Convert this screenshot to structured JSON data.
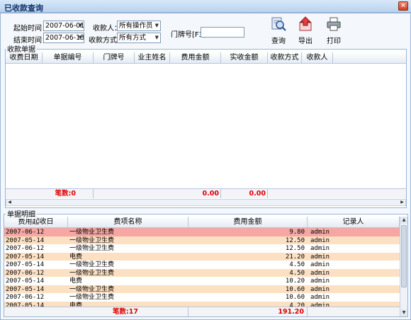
{
  "window": {
    "title": "已收款查询",
    "close_label": "×"
  },
  "filters": {
    "start_label": "起始时间：",
    "start_value": "2007-06-01",
    "end_label": "结束时间：",
    "end_value": "2007-06-13",
    "collector_label": "收款人：",
    "collector_value": "所有操作员",
    "method_label": "收款方式：",
    "method_value": "所有方式",
    "door_label": "门牌号[F3]",
    "door_value": ""
  },
  "toolbar": {
    "query_label": "查询",
    "export_label": "导出",
    "print_label": "打印"
  },
  "receipts": {
    "group_label": "收款单据",
    "columns": [
      "收费日期",
      "单据编号",
      "门牌号",
      "业主姓名",
      "费用金额",
      "实收金额",
      "收款方式",
      "收款人"
    ],
    "summary": {
      "count_label": "笔数:0",
      "fee_total": "0.00",
      "received_total": "0.00"
    }
  },
  "details": {
    "group_label": "单据明细",
    "columns": [
      "费用起收日",
      "费项名称",
      "费用金额",
      "记录人"
    ],
    "rows": [
      {
        "date": "2007-06-12",
        "item": "一级物业卫生费",
        "amount": "9.80",
        "recorder": "admin"
      },
      {
        "date": "2007-05-14",
        "item": "一级物业卫生费",
        "amount": "12.50",
        "recorder": "admin"
      },
      {
        "date": "2007-06-12",
        "item": "一级物业卫生费",
        "amount": "12.50",
        "recorder": "admin"
      },
      {
        "date": "2007-05-14",
        "item": "电费",
        "amount": "21.20",
        "recorder": "admin"
      },
      {
        "date": "2007-05-14",
        "item": "一级物业卫生费",
        "amount": "4.50",
        "recorder": "admin"
      },
      {
        "date": "2007-06-12",
        "item": "一级物业卫生费",
        "amount": "4.50",
        "recorder": "admin"
      },
      {
        "date": "2007-05-14",
        "item": "电费",
        "amount": "10.20",
        "recorder": "admin"
      },
      {
        "date": "2007-05-14",
        "item": "一级物业卫生费",
        "amount": "10.60",
        "recorder": "admin"
      },
      {
        "date": "2007-06-12",
        "item": "一级物业卫生费",
        "amount": "10.60",
        "recorder": "admin"
      },
      {
        "date": "2007-05-14",
        "item": "电费",
        "amount": "4.20",
        "recorder": "admin"
      }
    ],
    "summary": {
      "count_label": "笔数:17",
      "amount_total": "191.20"
    }
  },
  "colors": {
    "selected_row": "#f4a7a3",
    "stripe_row": "#fbe0c4",
    "plain_row": "#ffffff",
    "total_text": "#e00000"
  }
}
